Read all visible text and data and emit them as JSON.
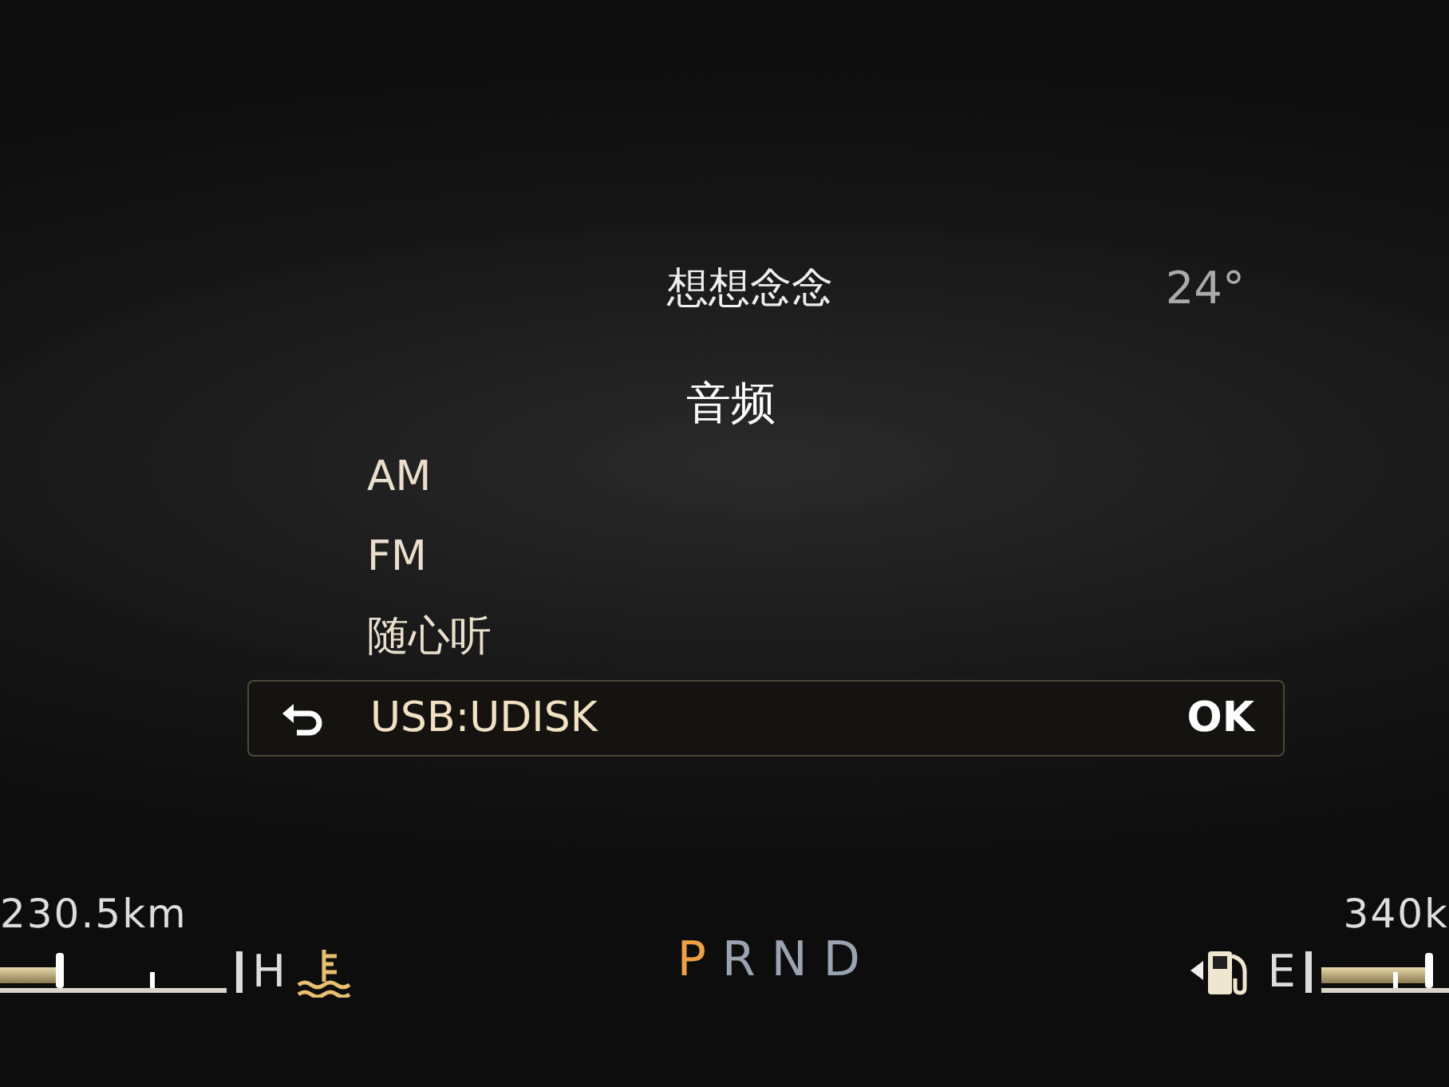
{
  "header": {
    "title": "想想念念",
    "temperature": "24°"
  },
  "menu": {
    "title": "音频",
    "confirm": "OK",
    "items": [
      {
        "label": "AM",
        "selected": false
      },
      {
        "label": "FM",
        "selected": false
      },
      {
        "label": "随心听",
        "selected": false
      },
      {
        "label": "USB:UDISK",
        "selected": true
      }
    ]
  },
  "coolant_gauge": {
    "range": "230.5km",
    "label": "H",
    "level": 0.27
  },
  "gear_selector": [
    {
      "label": "P",
      "selected": true
    },
    {
      "label": "R",
      "selected": false
    },
    {
      "label": "N",
      "selected": false
    },
    {
      "label": "D",
      "selected": false
    }
  ],
  "fuel_gauge": {
    "range": "340k",
    "label": "E",
    "level": 0.85
  }
}
